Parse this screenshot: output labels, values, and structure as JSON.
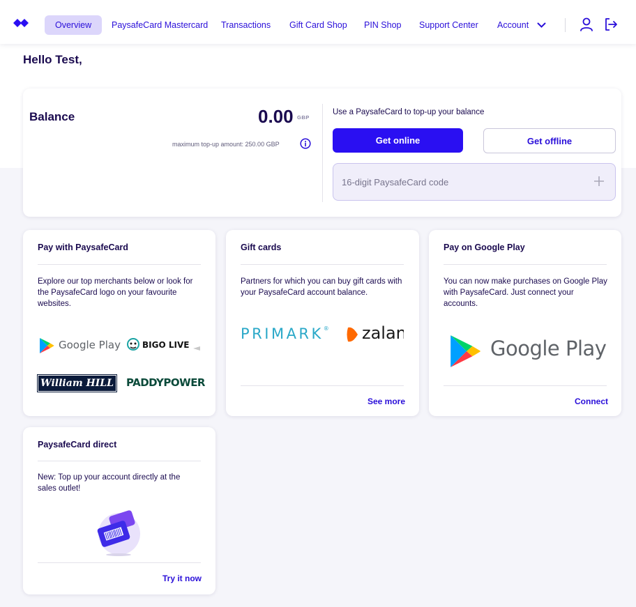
{
  "nav": {
    "items": [
      {
        "label": "Overview",
        "active": true
      },
      {
        "label": "PaysafeCard Mastercard"
      },
      {
        "label": "Transactions"
      },
      {
        "label": "Gift Card Shop"
      },
      {
        "label": "PIN Shop"
      },
      {
        "label": "Support Center"
      },
      {
        "label": "Account"
      }
    ],
    "icons": [
      "user-icon",
      "logout-icon"
    ]
  },
  "greeting": "Hello Test,",
  "balance": {
    "title": "Balance",
    "amount": "0.00",
    "currency": "GBP",
    "max_topup": "maximum top-up amount: 250.00 GBP",
    "topup_text": "Use a PaysafeCard to top-up your balance",
    "online_label": "Get online",
    "offline_label": "Get offline",
    "code_placeholder": "16-digit PaysafeCard code"
  },
  "cards": {
    "pay": {
      "title": "Pay with PaysafeCard",
      "desc": "Explore our top merchants below or look for the PaysafeCard logo on your favourite websites.",
      "logos": {
        "google_play": "Google Play",
        "bigo": "BIGO LIVE",
        "william_hill": "William HILL",
        "paddy": "PADDYPOWER"
      }
    },
    "gift": {
      "title": "Gift cards",
      "desc": "Partners for which you can buy gift cards with your PaysafeCard account balance.",
      "logos": {
        "primark": "PRIMARK",
        "primark_mark": "®",
        "zalando": "zalan"
      },
      "link": "See more"
    },
    "google": {
      "title": "Pay on Google Play",
      "desc": "You can now make purchases on Google Play with PaysafeCard. Just connect your accounts.",
      "logo_text": "Google Play",
      "link": "Connect"
    },
    "direct": {
      "title": "PaysafeCard direct",
      "desc": "New: Top up your account directly at the sales outlet!",
      "link": "Try it now"
    }
  },
  "colors": {
    "accent": "#2a0ff2",
    "text": "#1a0a4f",
    "active_tab": "#dcd6fb",
    "page_bg": "#f5f5fa"
  }
}
